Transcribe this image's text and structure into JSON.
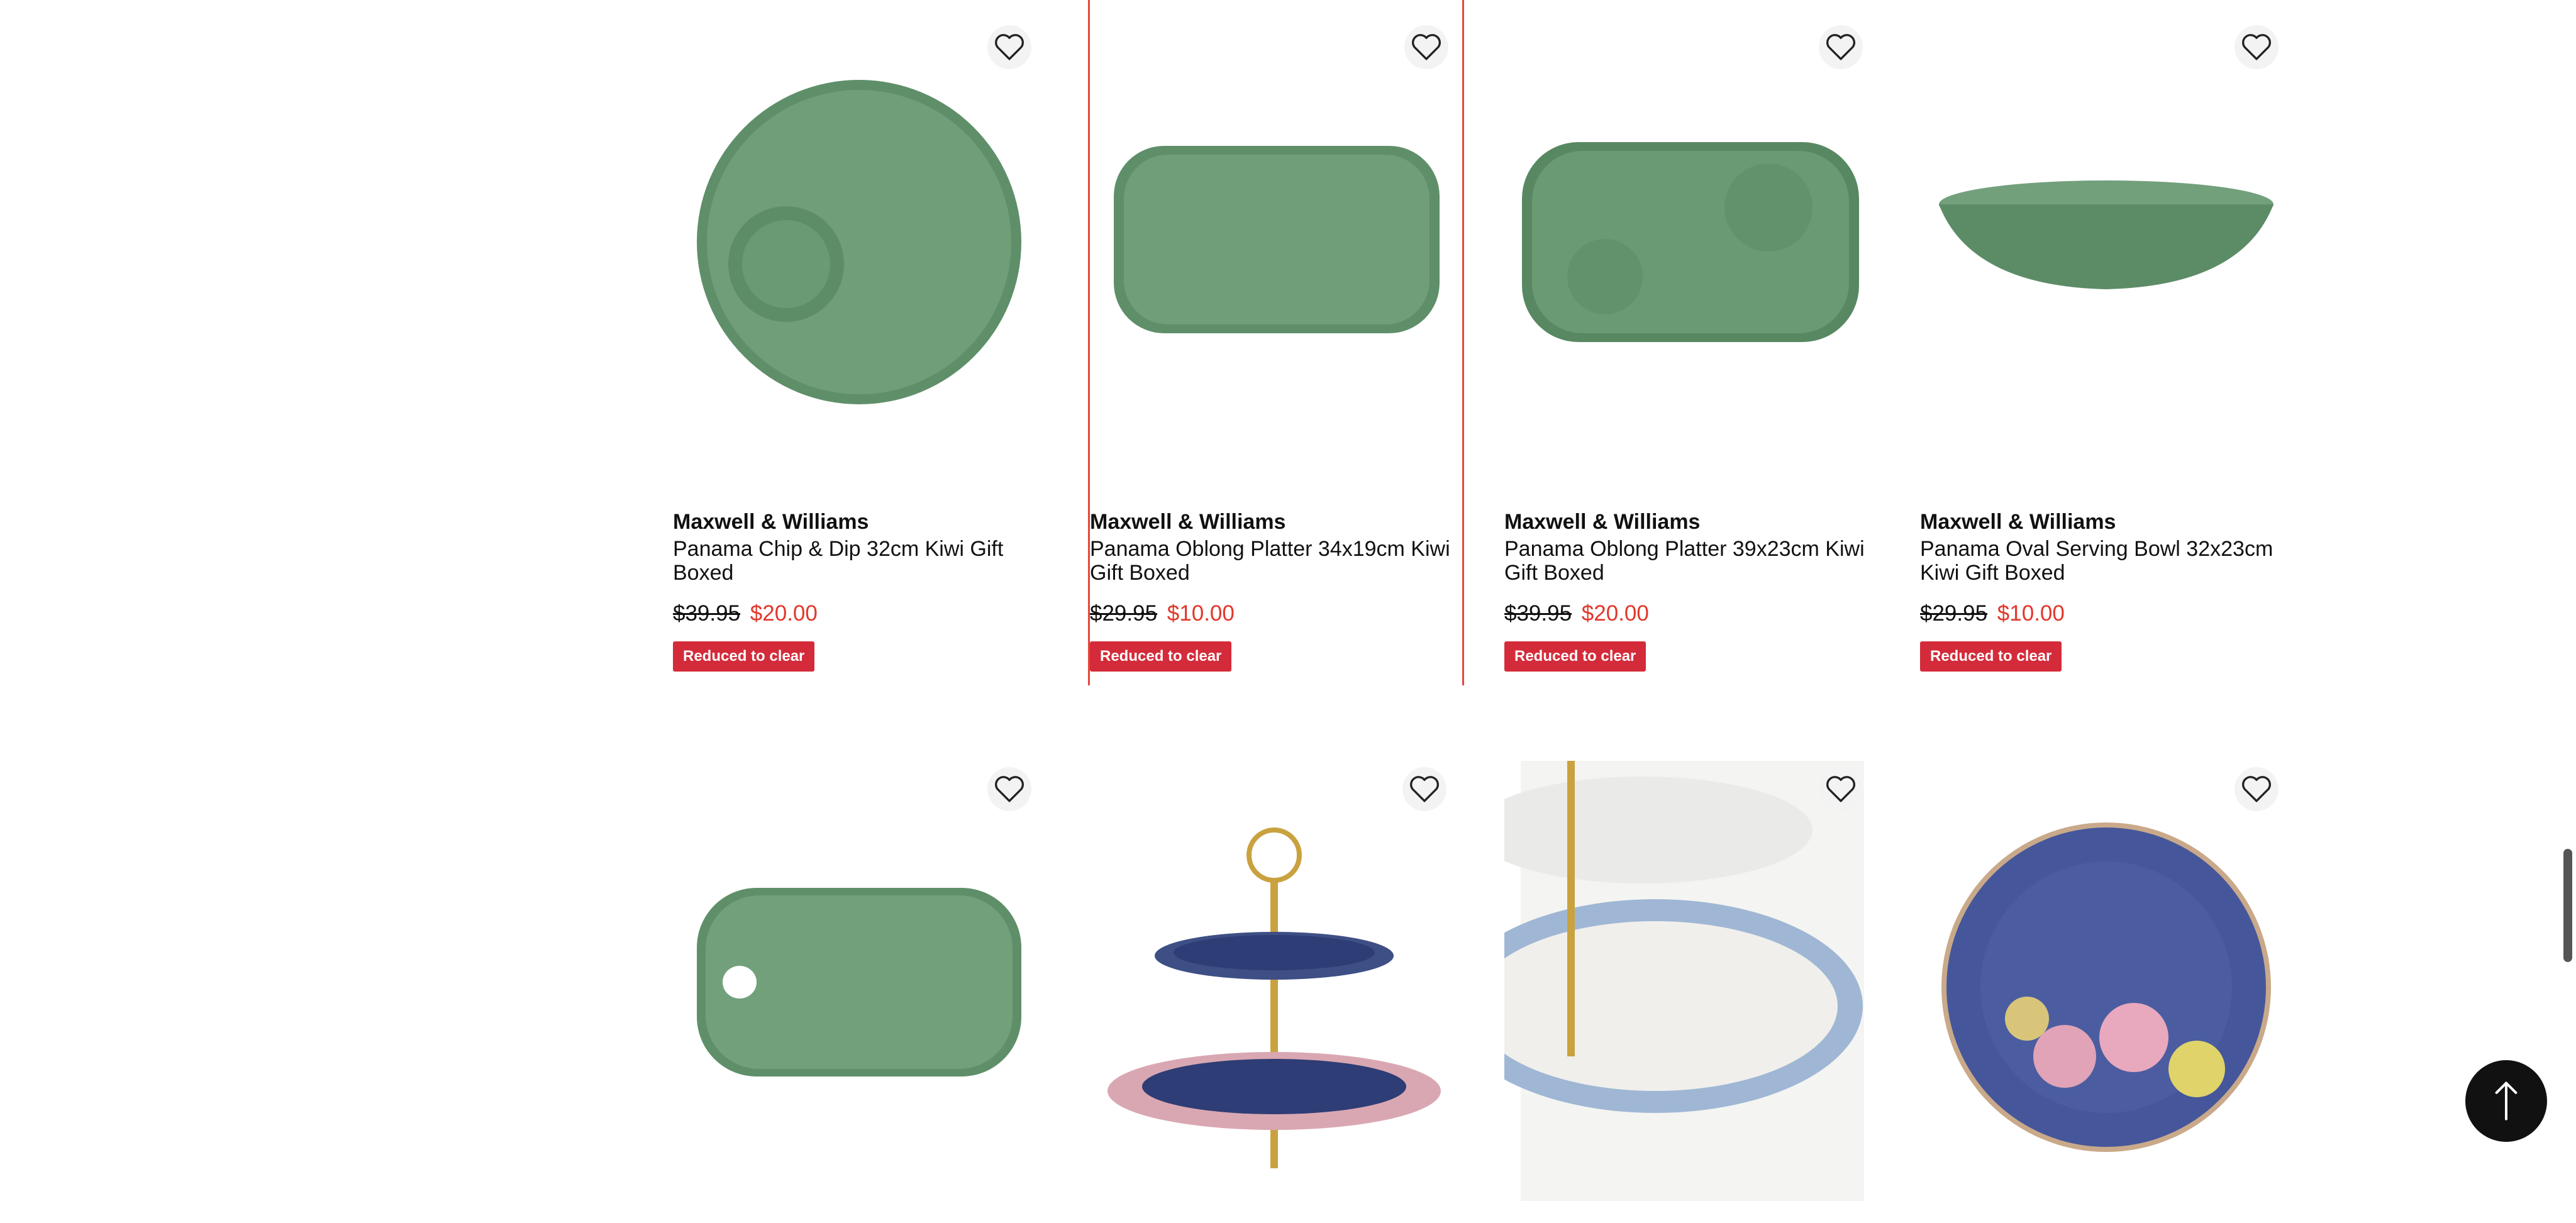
{
  "products": [
    {
      "brand": "Maxwell & Williams",
      "title": "Panama Chip & Dip 32cm Kiwi Gift Boxed",
      "price_was": "$39.95",
      "price_now": "$20.00",
      "badge": "Reduced to clear"
    },
    {
      "brand": "Maxwell & Williams",
      "title": "Panama Oblong Platter 34x19cm Kiwi Gift Boxed",
      "price_was": "$29.95",
      "price_now": "$10.00",
      "badge": "Reduced to clear"
    },
    {
      "brand": "Maxwell & Williams",
      "title": "Panama Oblong Platter 39x23cm Kiwi Gift Boxed",
      "price_was": "$39.95",
      "price_now": "$20.00",
      "badge": "Reduced to clear"
    },
    {
      "brand": "Maxwell & Williams",
      "title": "Panama Oval Serving Bowl 32x23cm Kiwi Gift Boxed",
      "price_was": "$29.95",
      "price_now": "$10.00",
      "badge": "Reduced to clear"
    }
  ],
  "icons": {
    "wishlist": "heart-icon",
    "back_to_top": "arrow-up-icon"
  },
  "colors": {
    "sale_price": "#e2372b",
    "badge_bg": "#d42b3a",
    "highlight_border": "#e6473a"
  }
}
